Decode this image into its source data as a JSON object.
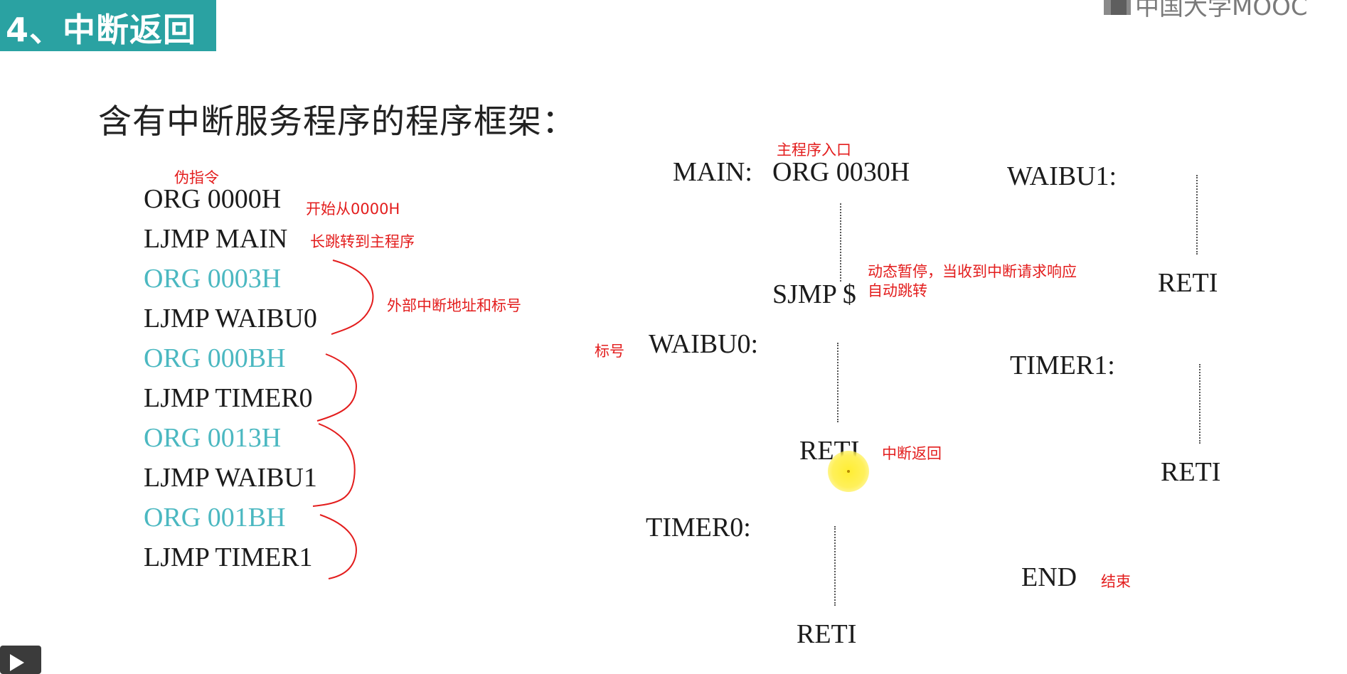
{
  "header": {
    "section_title": "4、中断返回",
    "logo_text": "中国大学MOOC"
  },
  "slide": {
    "title": "含有中断服务程序的程序框架："
  },
  "left_code": {
    "note_pseudo": "伪指令",
    "lines": [
      {
        "text": "ORG 0000H",
        "color": "#1b1b1b"
      },
      {
        "text": "LJMP MAIN",
        "color": "#1b1b1b"
      },
      {
        "text": "ORG 0003H",
        "color": "#4bb8c1"
      },
      {
        "text": "LJMP WAIBU0",
        "color": "#1b1b1b"
      },
      {
        "text": "ORG 000BH",
        "color": "#4bb8c1"
      },
      {
        "text": "LJMP TIMER0",
        "color": "#1b1b1b"
      },
      {
        "text": "ORG 0013H",
        "color": "#4bb8c1"
      },
      {
        "text": "LJMP WAIBU1",
        "color": "#1b1b1b"
      },
      {
        "text": "ORG 001BH",
        "color": "#4bb8c1"
      },
      {
        "text": "LJMP TIMER1",
        "color": "#1b1b1b"
      }
    ],
    "note_start": "开始从0000H",
    "note_ljmp": "长跳转到主程序",
    "note_ext": "外部中断地址和标号"
  },
  "middle_code": {
    "main_entry_note": "主程序入口",
    "main_label": "MAIN:",
    "main_org": "ORG 0030H",
    "sjmp": "SJMP $",
    "sjmp_note_1": "动态暂停，当收到中断请求响应",
    "sjmp_note_2": "自动跳转",
    "label_note": "标号",
    "waibu0": "WAIBU0:",
    "reti_1": "RETI",
    "reti_note": "中断返回",
    "timer0": "TIMER0:",
    "reti_2": "RETI"
  },
  "right_code": {
    "waibu1": "WAIBU1:",
    "reti_1": "RETI",
    "timer1": "TIMER1:",
    "reti_2": "RETI",
    "end": "END",
    "end_note": "结束"
  },
  "colors": {
    "badge": "#2aa2a2",
    "annotation": "#e31d1d",
    "cyan_code": "#4bb8c1"
  },
  "icons": [
    "play-icon",
    "mooc-logo-icon",
    "cursor-highlight"
  ]
}
